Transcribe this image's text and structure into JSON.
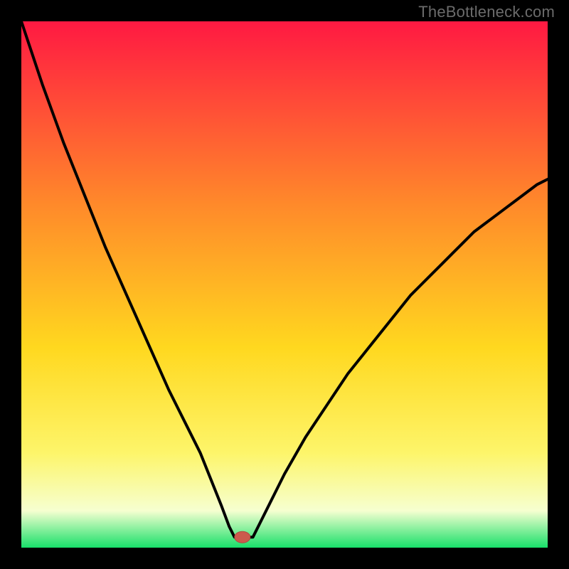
{
  "watermark": "TheBottleneck.com",
  "colors": {
    "frame": "#000000",
    "curve": "#000000",
    "marker_fill": "#cc5a4d",
    "marker_stroke": "#b04a3f",
    "gradient": {
      "top": "#ff1942",
      "upper_mid": "#ff8a2a",
      "mid": "#ffd81f",
      "lower_mid": "#fdf56a",
      "pale": "#f6ffd0",
      "bottom": "#18e06a"
    }
  },
  "chart_data": {
    "type": "line",
    "title": "",
    "xlabel": "",
    "ylabel": "",
    "xlim": [
      0,
      100
    ],
    "ylim": [
      0,
      100
    ],
    "annotation_marker": {
      "x": 42,
      "y": 2
    },
    "left_curve": {
      "name": "left-curve",
      "x": [
        0,
        2,
        4,
        6,
        8,
        10,
        12,
        14,
        16,
        18,
        20,
        22,
        24,
        26,
        28,
        30,
        32,
        34,
        36,
        38,
        39.5,
        40.5
      ],
      "values": [
        100,
        94,
        88,
        82.5,
        77,
        72,
        67,
        62,
        57,
        52.5,
        48,
        43.5,
        39,
        34.5,
        30,
        26,
        22,
        18,
        13,
        8,
        4,
        2
      ]
    },
    "min_floor": {
      "name": "min-floor",
      "x": [
        40.5,
        44
      ],
      "values": [
        2,
        2
      ]
    },
    "right_curve": {
      "name": "right-curve",
      "x": [
        44,
        46,
        48,
        50,
        52,
        54,
        56,
        58,
        60,
        62,
        64,
        66,
        68,
        70,
        72,
        74,
        76,
        78,
        80,
        82,
        84,
        86,
        88,
        90,
        92,
        94,
        96,
        98,
        100
      ],
      "values": [
        2,
        6,
        10,
        14,
        17.5,
        21,
        24,
        27,
        30,
        33,
        35.5,
        38,
        40.5,
        43,
        45.5,
        48,
        50,
        52,
        54,
        56,
        58,
        60,
        61.5,
        63,
        64.5,
        66,
        67.5,
        69,
        70
      ]
    }
  }
}
